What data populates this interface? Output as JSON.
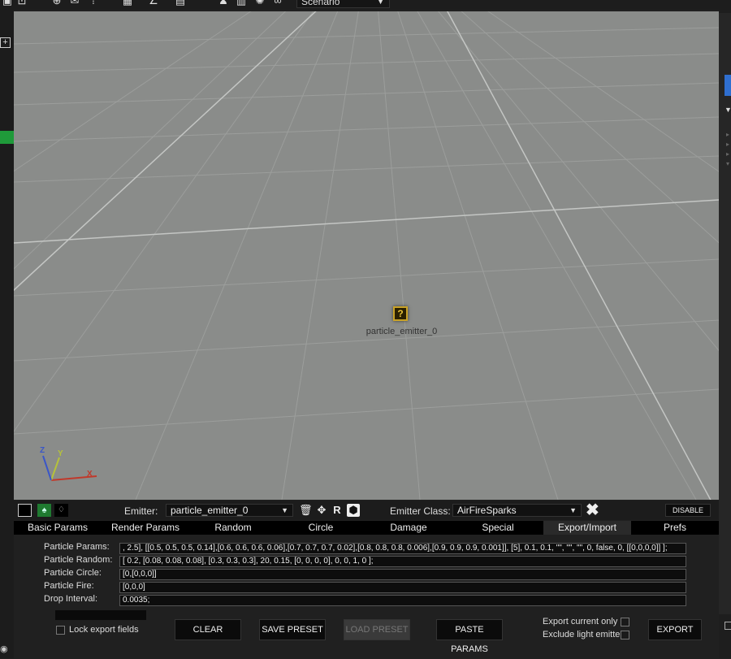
{
  "toolbar": {
    "scenario_label": "Scenario"
  },
  "viewport": {
    "emitter_icon_glyph": "?",
    "emitter_name": "particle_emitter_0",
    "axis_x": "X",
    "axis_y": "Y",
    "axis_z": "Z"
  },
  "emitter_bar": {
    "emitter_label": "Emitter:",
    "emitter_value": "particle_emitter_0",
    "class_label": "Emitter Class:",
    "class_value": "AirFireSparks",
    "disable_label": "DISABLE"
  },
  "tabs": [
    {
      "label": "Basic Params"
    },
    {
      "label": "Render Params"
    },
    {
      "label": "Random"
    },
    {
      "label": "Circle"
    },
    {
      "label": "Damage"
    },
    {
      "label": "Special"
    },
    {
      "label": "Export/Import"
    },
    {
      "label": "Prefs"
    }
  ],
  "params": {
    "particle_params_label": "Particle Params:",
    "particle_params_value": ", 2.5], [[0.5, 0.5, 0.5, 0.14],[0.6, 0.6, 0.6, 0.06],[0.7, 0.7, 0.7, 0.02],[0.8, 0.8, 0.8, 0.006],[0.9, 0.9, 0.9, 0.001]], [5], 0.1, 0.1, \"\", \"\", \"\", 0, false, 0, [[0,0,0,0]] ];",
    "particle_random_label": "Particle Random:",
    "particle_random_value": "[ 0.2, [0.08, 0.08, 0.08], [0.3, 0.3, 0.3], 20, 0.15, [0, 0, 0, 0], 0, 0, 1, 0 ];",
    "particle_circle_label": "Particle Circle:",
    "particle_circle_value": "[0,[0,0,0]]",
    "particle_fire_label": "Particle Fire:",
    "particle_fire_value": "[0,0,0]",
    "drop_interval_label": "Drop Interval:",
    "drop_interval_value": "0.0035;"
  },
  "footer": {
    "lock_export_label": "Lock export fields",
    "clear_label": "CLEAR",
    "save_preset_label": "SAVE PRESET",
    "load_preset_label": "LOAD PRESET",
    "paste_params_label": "PASTE PARAMS",
    "export_current_label": "Export current only",
    "exclude_light_label": "Exclude light emitters",
    "export_label": "EXPORT"
  },
  "colors": {
    "viewport_bg": "#8a8c8a",
    "accent_green": "#1f9a3a",
    "accent_blue": "#2f6fd0",
    "emitter_icon": "#c9a227"
  }
}
